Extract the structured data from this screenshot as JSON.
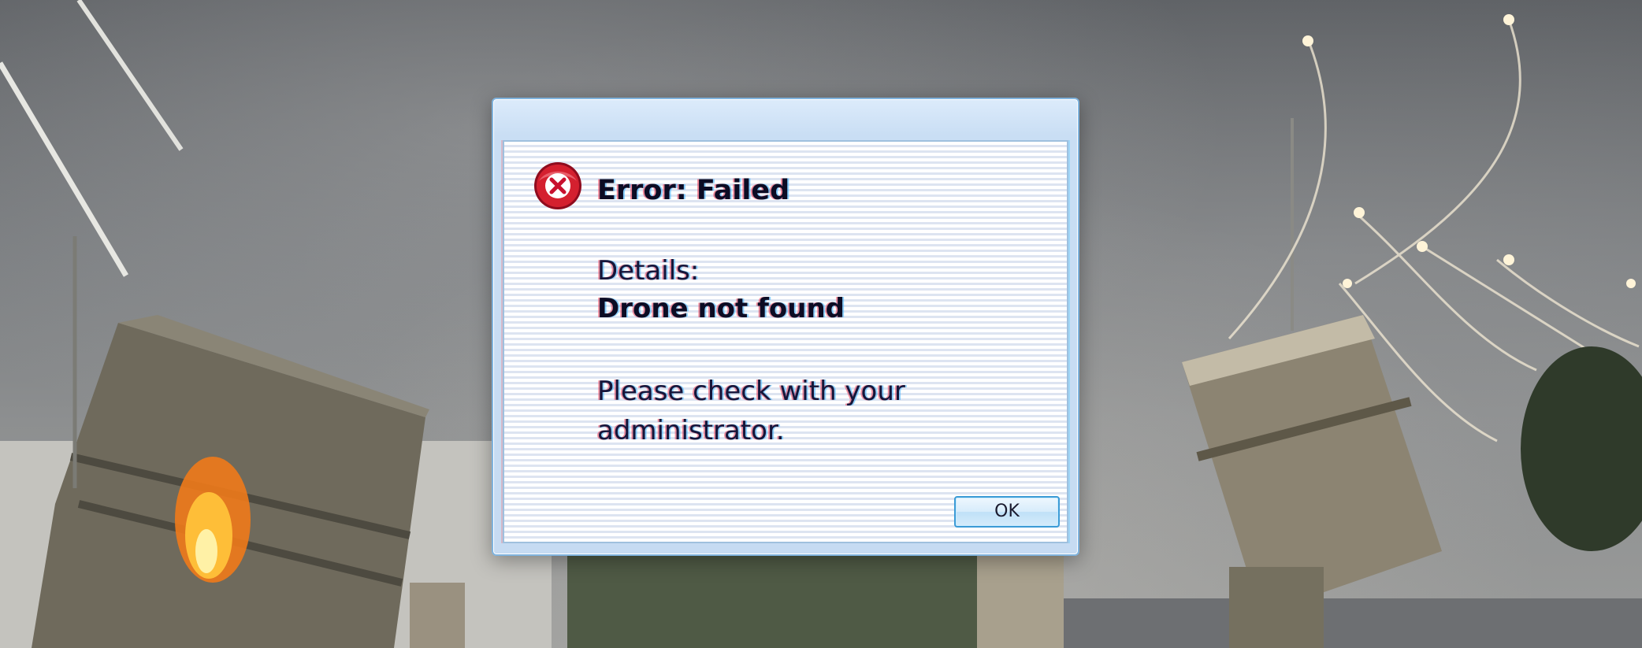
{
  "dialog": {
    "icon": "error-x-icon",
    "title": "Error: Failed",
    "details_label": "Details:",
    "details_value": "Drone not found",
    "message": "Please check with your administrator.",
    "ok_label": "OK"
  },
  "colors": {
    "dialog_frame": "#c6dbf2",
    "dialog_border": "#7fb3de",
    "error_icon": "#c8102e",
    "button_border": "#3c9bd6"
  }
}
